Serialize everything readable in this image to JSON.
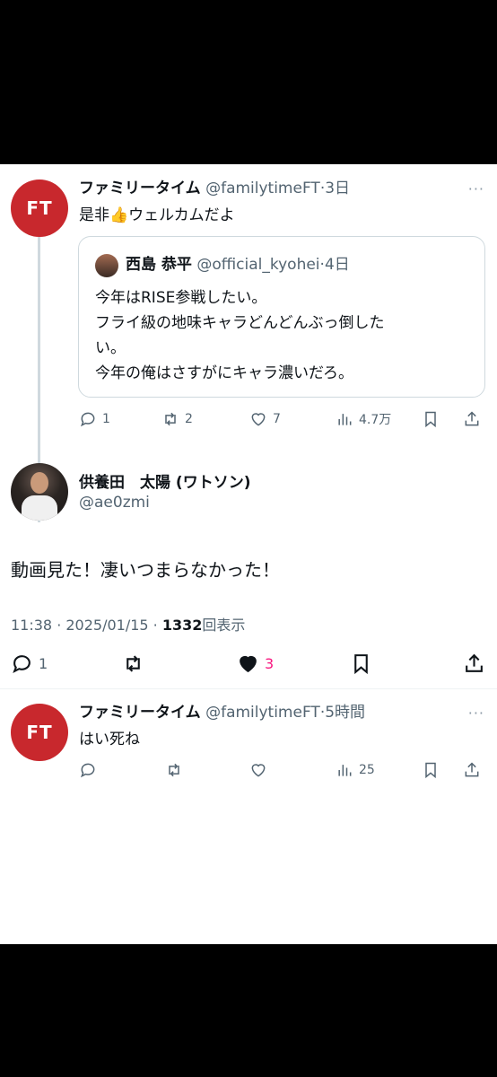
{
  "tweet1": {
    "avatar_text": "FT",
    "name": "ファミリータイム",
    "handle": "@familytimeFT",
    "time": "3日",
    "text_before": "是非",
    "emoji": "👍",
    "text_after": "ウェルカムだよ",
    "quote": {
      "name": "西島 恭平",
      "handle": "@official_kyohei",
      "time": "4日",
      "text": "今年はRISE参戦したい。\nフライ級の地味キャラどんどんぶっ倒した\nい。\n今年の俺はさすがにキャラ濃いだろ。"
    },
    "counts": {
      "replies": "1",
      "retweets": "2",
      "likes": "7",
      "views": "4.7万"
    }
  },
  "main": {
    "name": "供養田　太陽 (ワトソン)",
    "handle": "@ae0zmi",
    "text": "動画見た！凄いつまらなかった！",
    "time": "11:38 · 2025/01/15 · ",
    "views_count": "1332",
    "views_label": "回表示",
    "counts": {
      "replies": "1",
      "likes": "3"
    },
    "like_color": "#f91880"
  },
  "tweet3": {
    "avatar_text": "FT",
    "name": "ファミリータイム",
    "handle": "@familytimeFT",
    "time": "5時間",
    "text": "はい死ね",
    "counts": {
      "views": "25"
    }
  },
  "more_label": "···",
  "separator": "·",
  "brand_color": "#c8282d"
}
